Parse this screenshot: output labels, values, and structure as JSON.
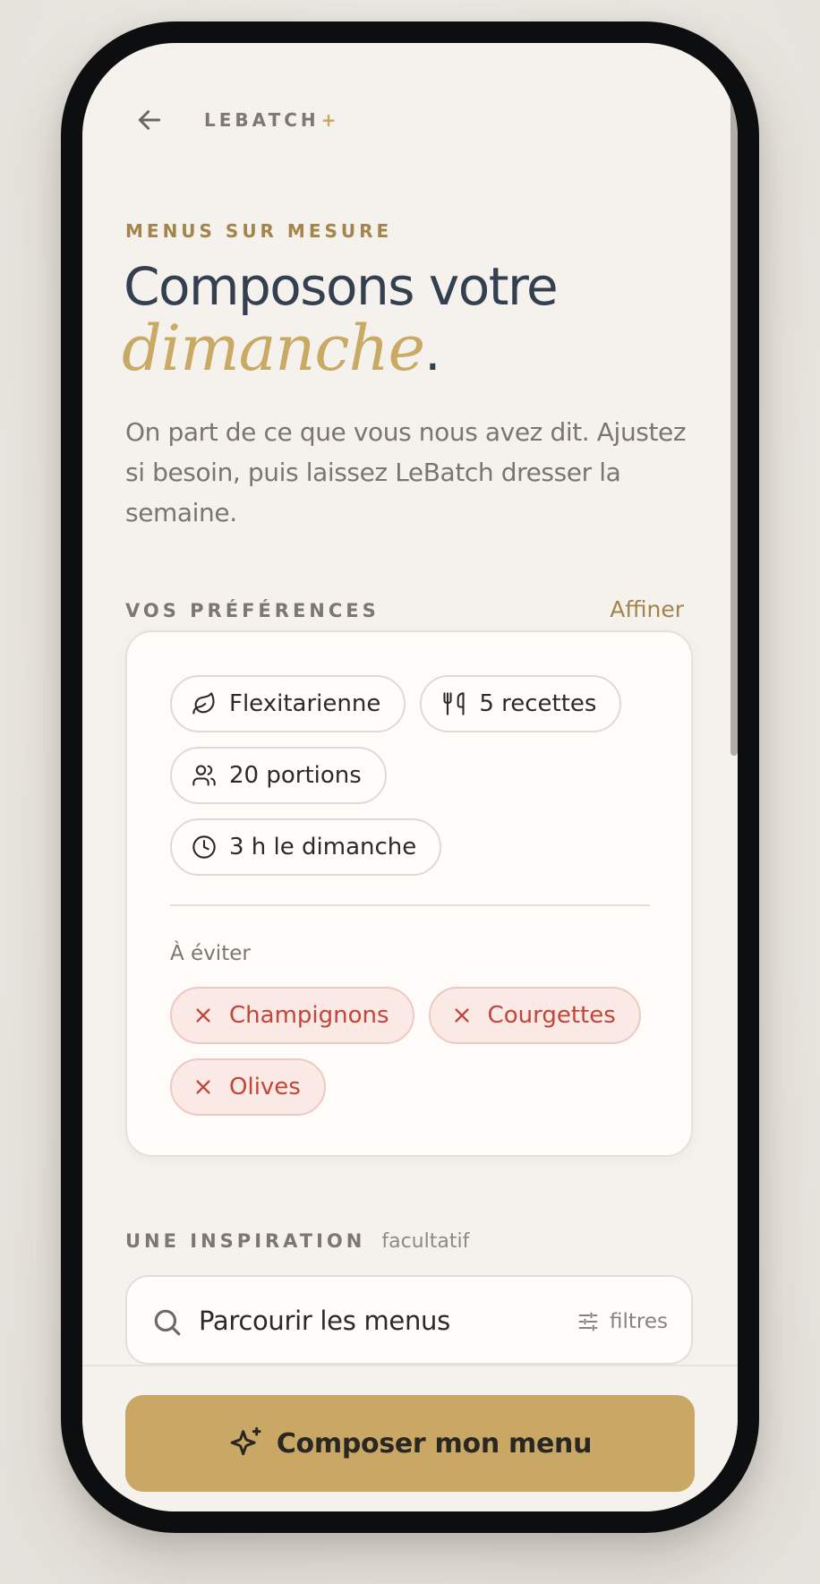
{
  "header": {
    "brand": "LEBATCH",
    "brand_mark": "+",
    "back_icon": "arrow-left-icon"
  },
  "hero": {
    "eyebrow": "MENUS SUR MESURE",
    "title_line1": "Composons votre",
    "title_line2": "dimanche",
    "title_dot": ".",
    "lead": "On part de ce que vous nous avez dit. Ajustez si besoin, puis laissez LeBatch dresser la semaine."
  },
  "preferences": {
    "label": "VOS PRÉFÉRENCES",
    "refine_link": "Affiner",
    "chips": [
      {
        "icon": "leaf-icon",
        "label": "Flexitarienne"
      },
      {
        "icon": "utensils-icon",
        "label": "5 recettes"
      },
      {
        "icon": "users-icon",
        "label": "20 portions"
      },
      {
        "icon": "clock-icon",
        "label": "3 h le dimanche"
      }
    ],
    "avoid_label": "À éviter",
    "avoid": [
      {
        "icon": "x-icon",
        "label": "Champignons"
      },
      {
        "icon": "x-icon",
        "label": "Courgettes"
      },
      {
        "icon": "x-icon",
        "label": "Olives"
      }
    ]
  },
  "inspiration": {
    "label": "UNE INSPIRATION",
    "hint": "facultatif",
    "search_text": "Parcourir les menus",
    "filters_label": "filtres"
  },
  "cta": {
    "label": "Composer mon menu",
    "icon": "sparkles-icon"
  },
  "colors": {
    "accent_gold": "#c9a865",
    "title_ink": "#34404f",
    "avoid_red": "#c2453a",
    "background": "#f5f2ed"
  }
}
